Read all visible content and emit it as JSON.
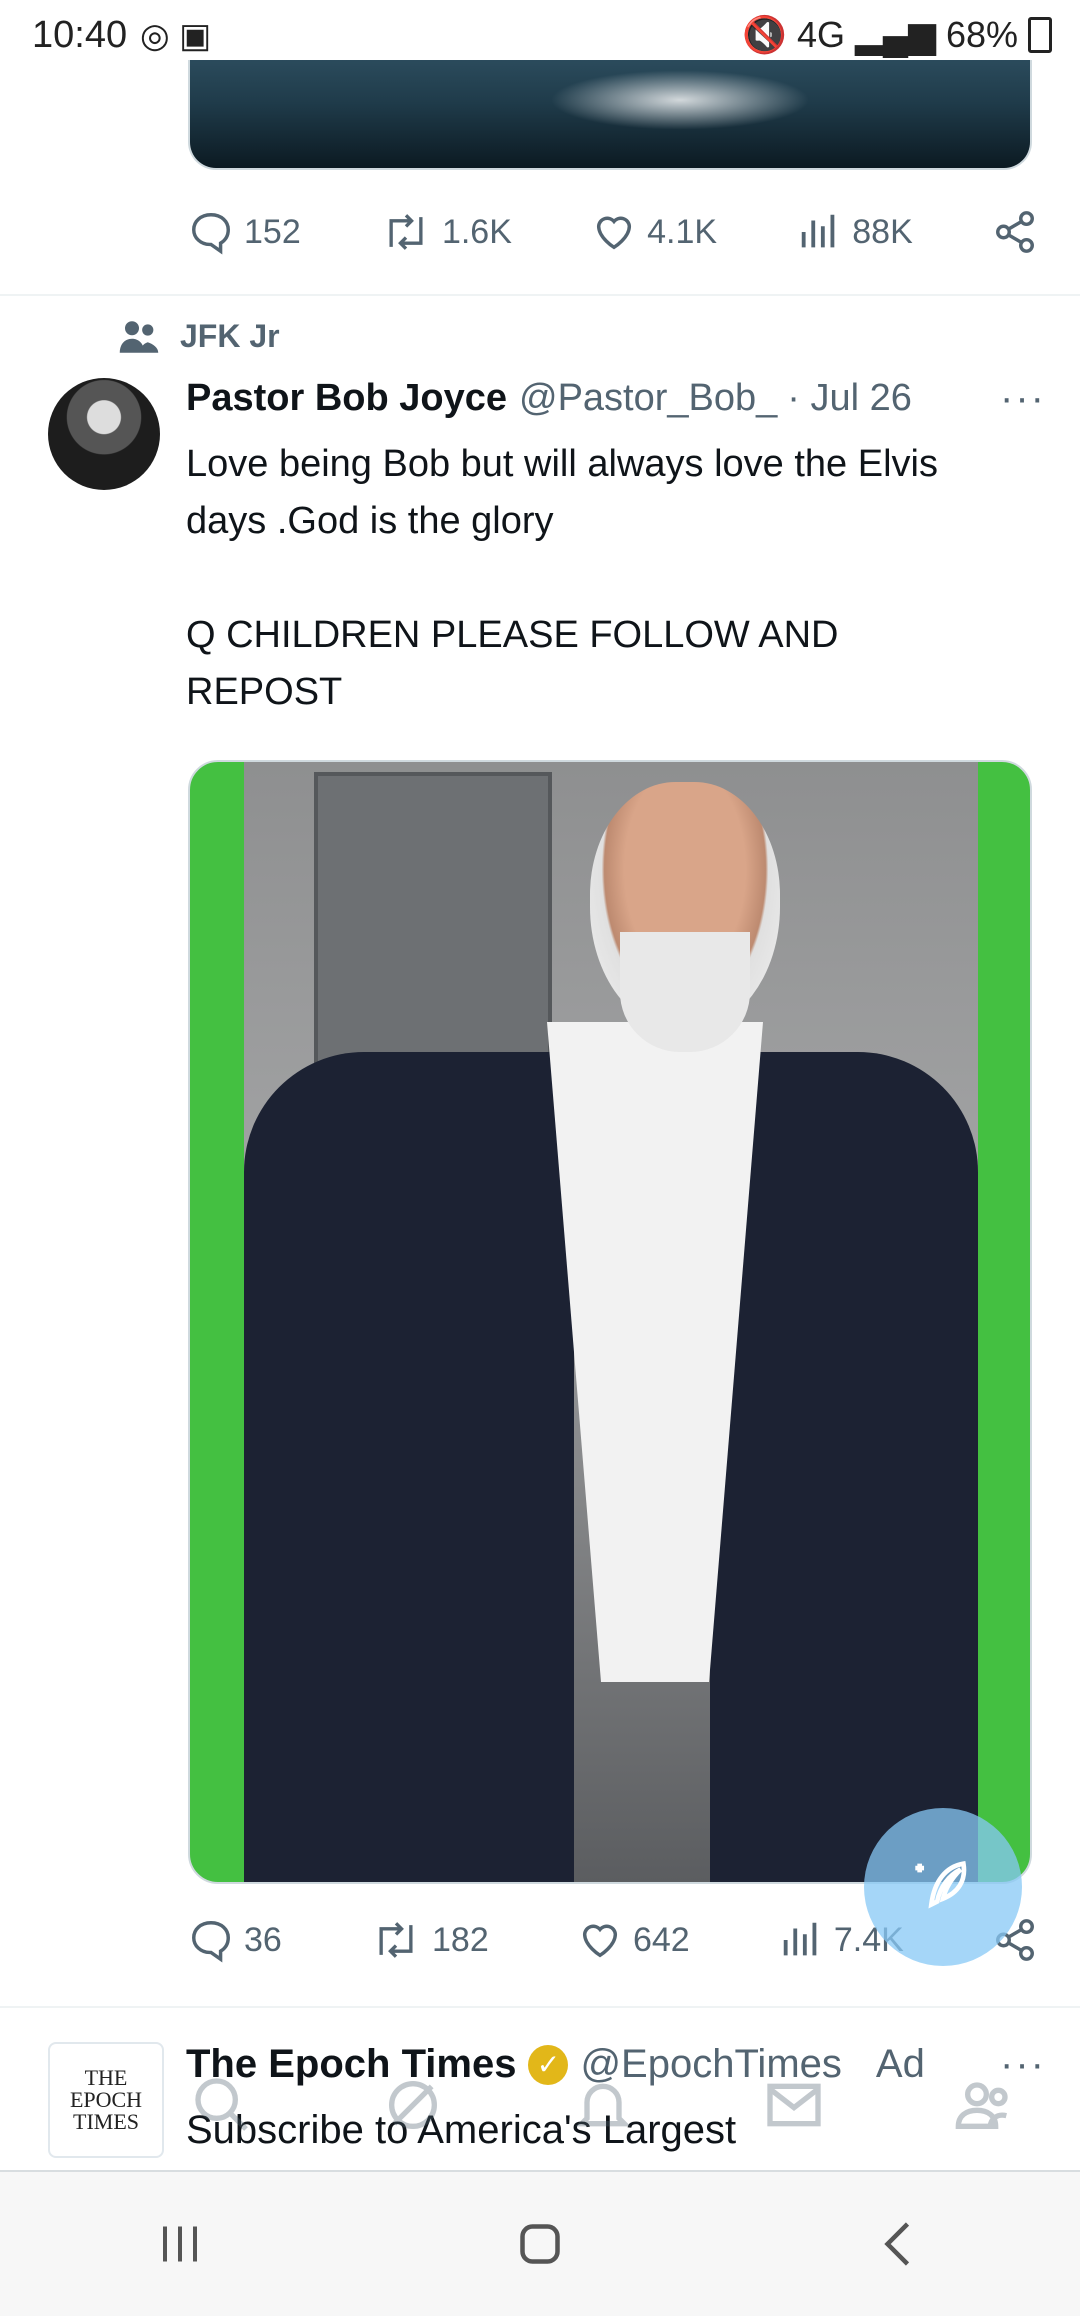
{
  "status_bar": {
    "time": "10:40",
    "right_icons": "🔇 4G ▂▄▆",
    "battery": "68%"
  },
  "previous_tweet": {
    "actions": {
      "replies": "152",
      "reposts": "1.6K",
      "likes": "4.1K",
      "views": "88K"
    }
  },
  "tweet": {
    "context_label": "JFK Jr",
    "author_name": "Pastor Bob Joyce",
    "handle": "@Pastor_Bob_",
    "date": "· Jul 26",
    "more": "···",
    "text": "Love being Bob but will always love the Elvis\ndays .God is the glory\n\nQ CHILDREN PLEASE FOLLOW AND\nREPOST",
    "actions": {
      "replies": "36",
      "reposts": "182",
      "likes": "642",
      "views": "7.4K"
    }
  },
  "ad_tweet": {
    "avatar_text": [
      "THE",
      "EPOCH",
      "TIMES"
    ],
    "author_name": "The Epoch Times",
    "handle": "@EpochTimes",
    "ad_label": "Ad",
    "more": "···",
    "text": "Subscribe to America's Largest"
  },
  "icons": {
    "reply": "reply-icon",
    "repost": "repost-icon",
    "like": "like-icon",
    "views": "views-icon",
    "share": "share-icon",
    "compose": "compose-icon"
  },
  "colors": {
    "text_primary": "#0f1419",
    "text_secondary": "#536471",
    "fab": "#87c8f5",
    "verified_gold": "#e2b719",
    "media_green": "#44c041"
  }
}
